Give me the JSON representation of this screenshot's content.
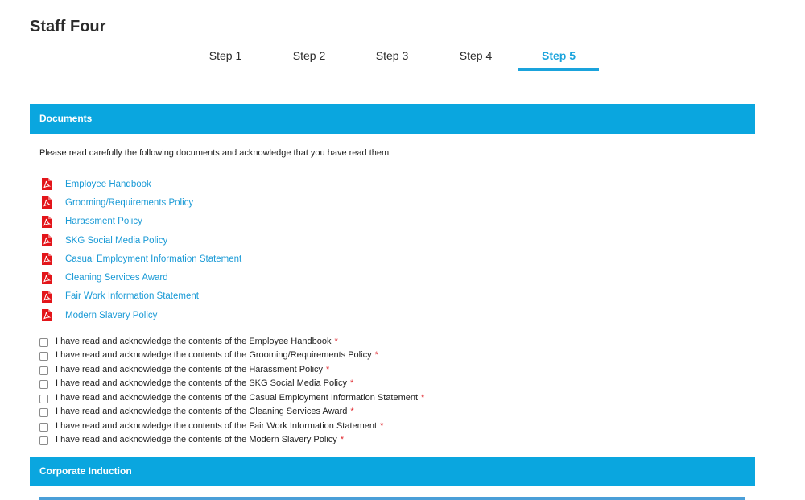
{
  "page": {
    "title": "Staff Four"
  },
  "steps": [
    {
      "label": "Step 1",
      "active": false
    },
    {
      "label": "Step 2",
      "active": false
    },
    {
      "label": "Step 3",
      "active": false
    },
    {
      "label": "Step 4",
      "active": false
    },
    {
      "label": "Step 5",
      "active": true
    }
  ],
  "documents": {
    "header": "Documents",
    "intro": "Please read carefully the following documents and acknowledge that you have read them",
    "items": [
      {
        "label": "Employee Handbook",
        "icon": "pdf-icon"
      },
      {
        "label": "Grooming/Requirements Policy",
        "icon": "pdf-icon"
      },
      {
        "label": "Harassment Policy",
        "icon": "pdf-icon"
      },
      {
        "label": "SKG Social Media Policy",
        "icon": "pdf-icon"
      },
      {
        "label": "Casual Employment Information Statement",
        "icon": "pdf-icon"
      },
      {
        "label": "Cleaning Services Award",
        "icon": "pdf-icon"
      },
      {
        "label": "Fair Work Information Statement",
        "icon": "pdf-icon"
      },
      {
        "label": "Modern Slavery Policy",
        "icon": "pdf-icon"
      }
    ],
    "acknowledgements": [
      {
        "label": "I have read and acknowledge the contents of the Employee Handbook",
        "required_mark": "*",
        "checked": false
      },
      {
        "label": "I have read and acknowledge the contents of the Grooming/Requirements Policy",
        "required_mark": "*",
        "checked": false
      },
      {
        "label": "I have read and acknowledge the contents of the Harassment Policy",
        "required_mark": "*",
        "checked": false
      },
      {
        "label": "I have read and acknowledge the contents of the SKG Social Media Policy",
        "required_mark": "*",
        "checked": false
      },
      {
        "label": "I have read and acknowledge the contents of the Casual Employment Information Statement",
        "required_mark": "*",
        "checked": false
      },
      {
        "label": "I have read and acknowledge the contents of the Cleaning Services Award",
        "required_mark": "*",
        "checked": false
      },
      {
        "label": "I have read and acknowledge the contents of the Fair Work Information Statement",
        "required_mark": "*",
        "checked": false
      },
      {
        "label": "I have read and acknowledge the contents of the Modern Slavery Policy",
        "required_mark": "*",
        "checked": false
      }
    ]
  },
  "induction": {
    "header": "Corporate Induction"
  },
  "colors": {
    "accent": "#0aa6df",
    "active_step": "#1aa3dc",
    "link": "#1a9ad6",
    "pdf_icon": "#e3151a",
    "required": "#e0282e"
  }
}
